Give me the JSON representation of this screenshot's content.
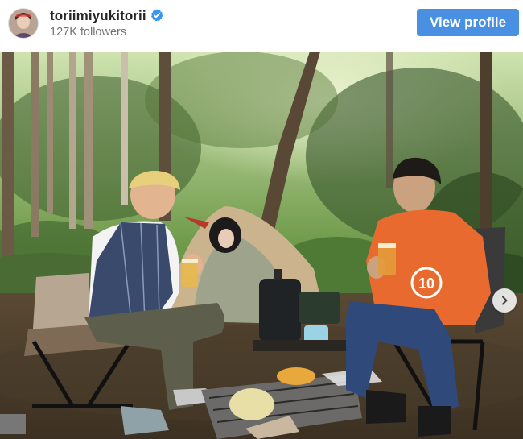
{
  "profile": {
    "username": "toriimiyukitorii",
    "followers": "127K followers",
    "verified": true,
    "avatar_icon": "profile-avatar"
  },
  "actions": {
    "view_profile": "View profile",
    "next_icon": "chevron-right-icon"
  },
  "photo": {
    "alt_icon": "camping-scene-photo",
    "shirt_number": "10"
  },
  "colors": {
    "button": "#4a90e2",
    "verified_badge": "#3897f0",
    "username": "#262626",
    "followers": "#737373"
  }
}
